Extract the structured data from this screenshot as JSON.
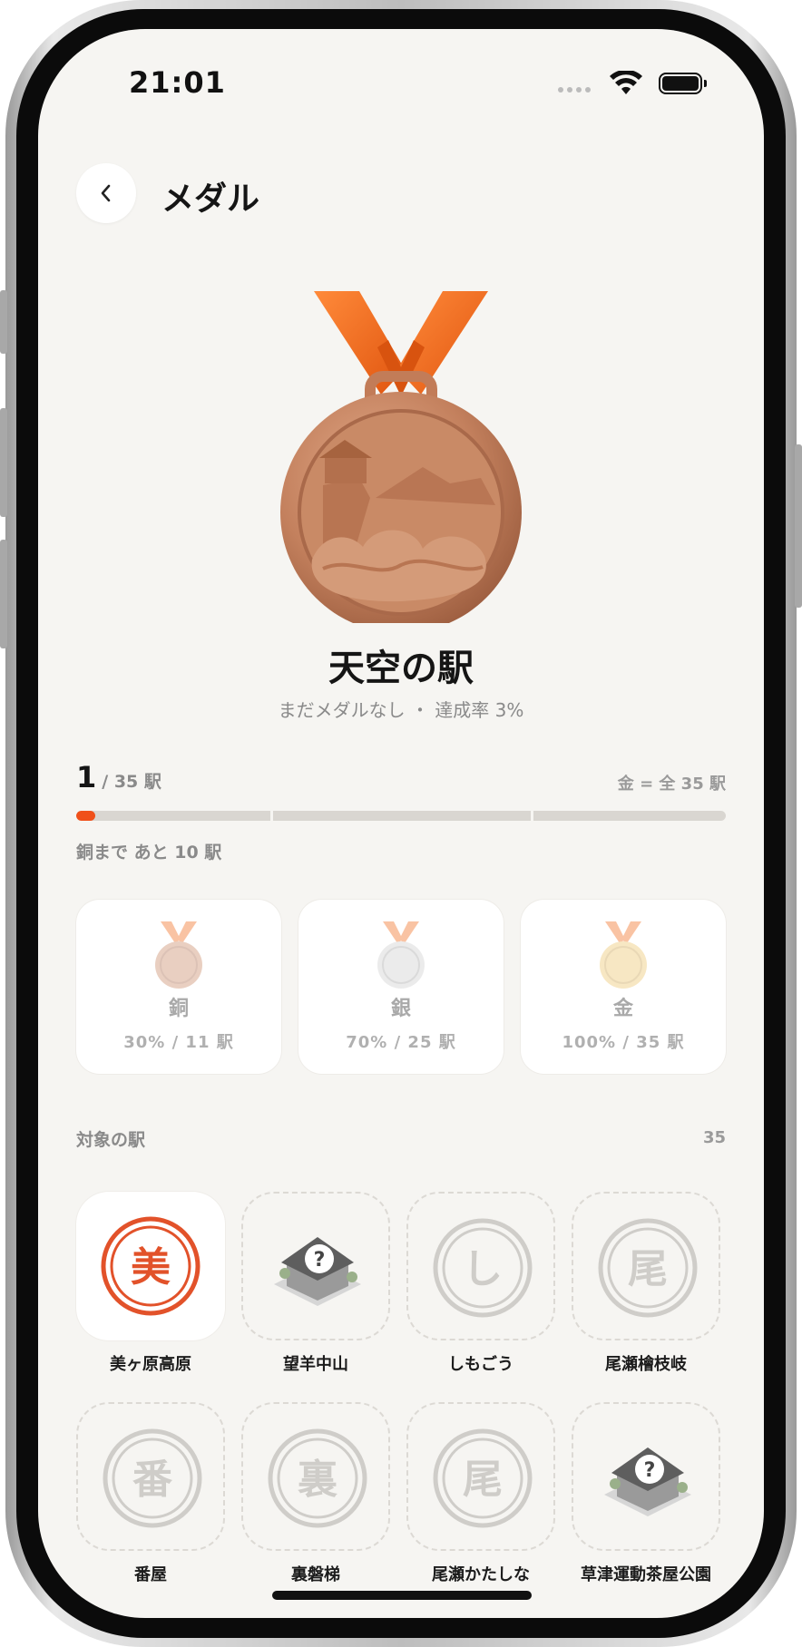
{
  "status_bar": {
    "time": "21:01"
  },
  "header": {
    "title": "メダル",
    "back_icon": "chevron-left-icon"
  },
  "medal": {
    "name": "天空の駅",
    "subtitle": "まだメダルなし ・ 達成率 3%",
    "colors": {
      "ribbon": "#f26a1b",
      "bronze": "#c98a66"
    }
  },
  "progress": {
    "current": "1",
    "total_text": "/ 35 駅",
    "gold_requirement": "金 = 全 35 駅",
    "remaining_text": "銅まで あと 10 駅",
    "fraction": 0.03,
    "accent": "#f0501a"
  },
  "tiers": [
    {
      "name": "銅",
      "requirement": "30% / 11 駅",
      "color": "#c98a66"
    },
    {
      "name": "銀",
      "requirement": "70% / 25 駅",
      "color": "#c9c9c9"
    },
    {
      "name": "金",
      "requirement": "100% / 35 駅",
      "color": "#e9c46a"
    }
  ],
  "stations_section": {
    "label": "対象の駅",
    "count": "35",
    "items": [
      {
        "name": "美ヶ原高原",
        "stamp": "美",
        "state": "collected"
      },
      {
        "name": "望羊中山",
        "stamp": "",
        "state": "unknown"
      },
      {
        "name": "しもごう",
        "stamp": "し",
        "state": "locked"
      },
      {
        "name": "尾瀬檜枝岐",
        "stamp": "尾",
        "state": "locked"
      },
      {
        "name": "番屋",
        "stamp": "番",
        "state": "locked"
      },
      {
        "name": "裏磐梯",
        "stamp": "裏",
        "state": "locked"
      },
      {
        "name": "尾瀬かたしな",
        "stamp": "尾",
        "state": "locked"
      },
      {
        "name": "草津運動茶屋公園",
        "stamp": "",
        "state": "unknown"
      }
    ]
  }
}
